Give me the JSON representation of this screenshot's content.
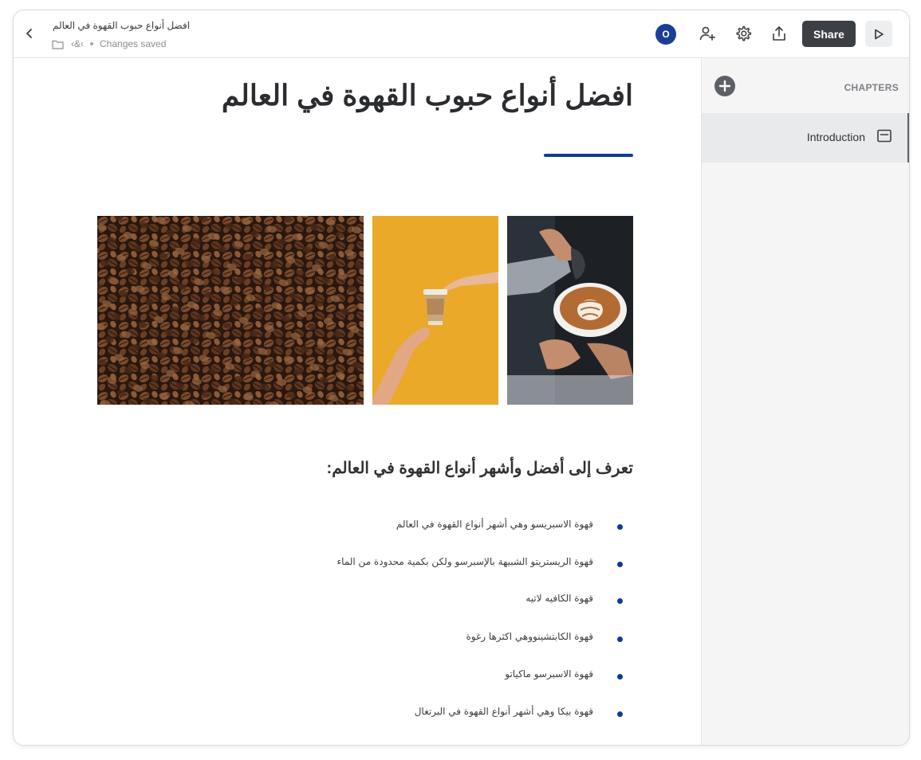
{
  "header": {
    "doc_title": "افضل أنواع حبوب القهوة في العالم",
    "breadcrumb": "‹&‹",
    "save_status": "Changes saved",
    "avatar_initial": "O",
    "share_label": "Share"
  },
  "document": {
    "title": "افضل أنواع حبوب القهوة في العالم",
    "subheading": "تعرف إلى أفضل وأشهر أنواع القهوة في العالم:",
    "bullets": [
      "قهوة الاسبريسو وهي أشهر أنواع القهوة في العالم",
      "قهوة الريستريتو الشبيهة بالإسبرسو ولكن بكمية محدودة من الماء",
      "قهوة الكافيه لاتيه",
      "قهوة الكابتشينووهي اكثرها رغوة",
      "قهوة الاسبرسو ماكياتو",
      "قهوة بيكا وهي أشهر أنواع القهوة في البرتغال"
    ]
  },
  "sidebar": {
    "heading": "CHAPTERS",
    "chapters": [
      {
        "label": "Introduction"
      }
    ]
  },
  "colors": {
    "accent": "#0f3a9e",
    "share_button": "#3c3f43",
    "sidebar_bg": "#f5f5f6"
  }
}
